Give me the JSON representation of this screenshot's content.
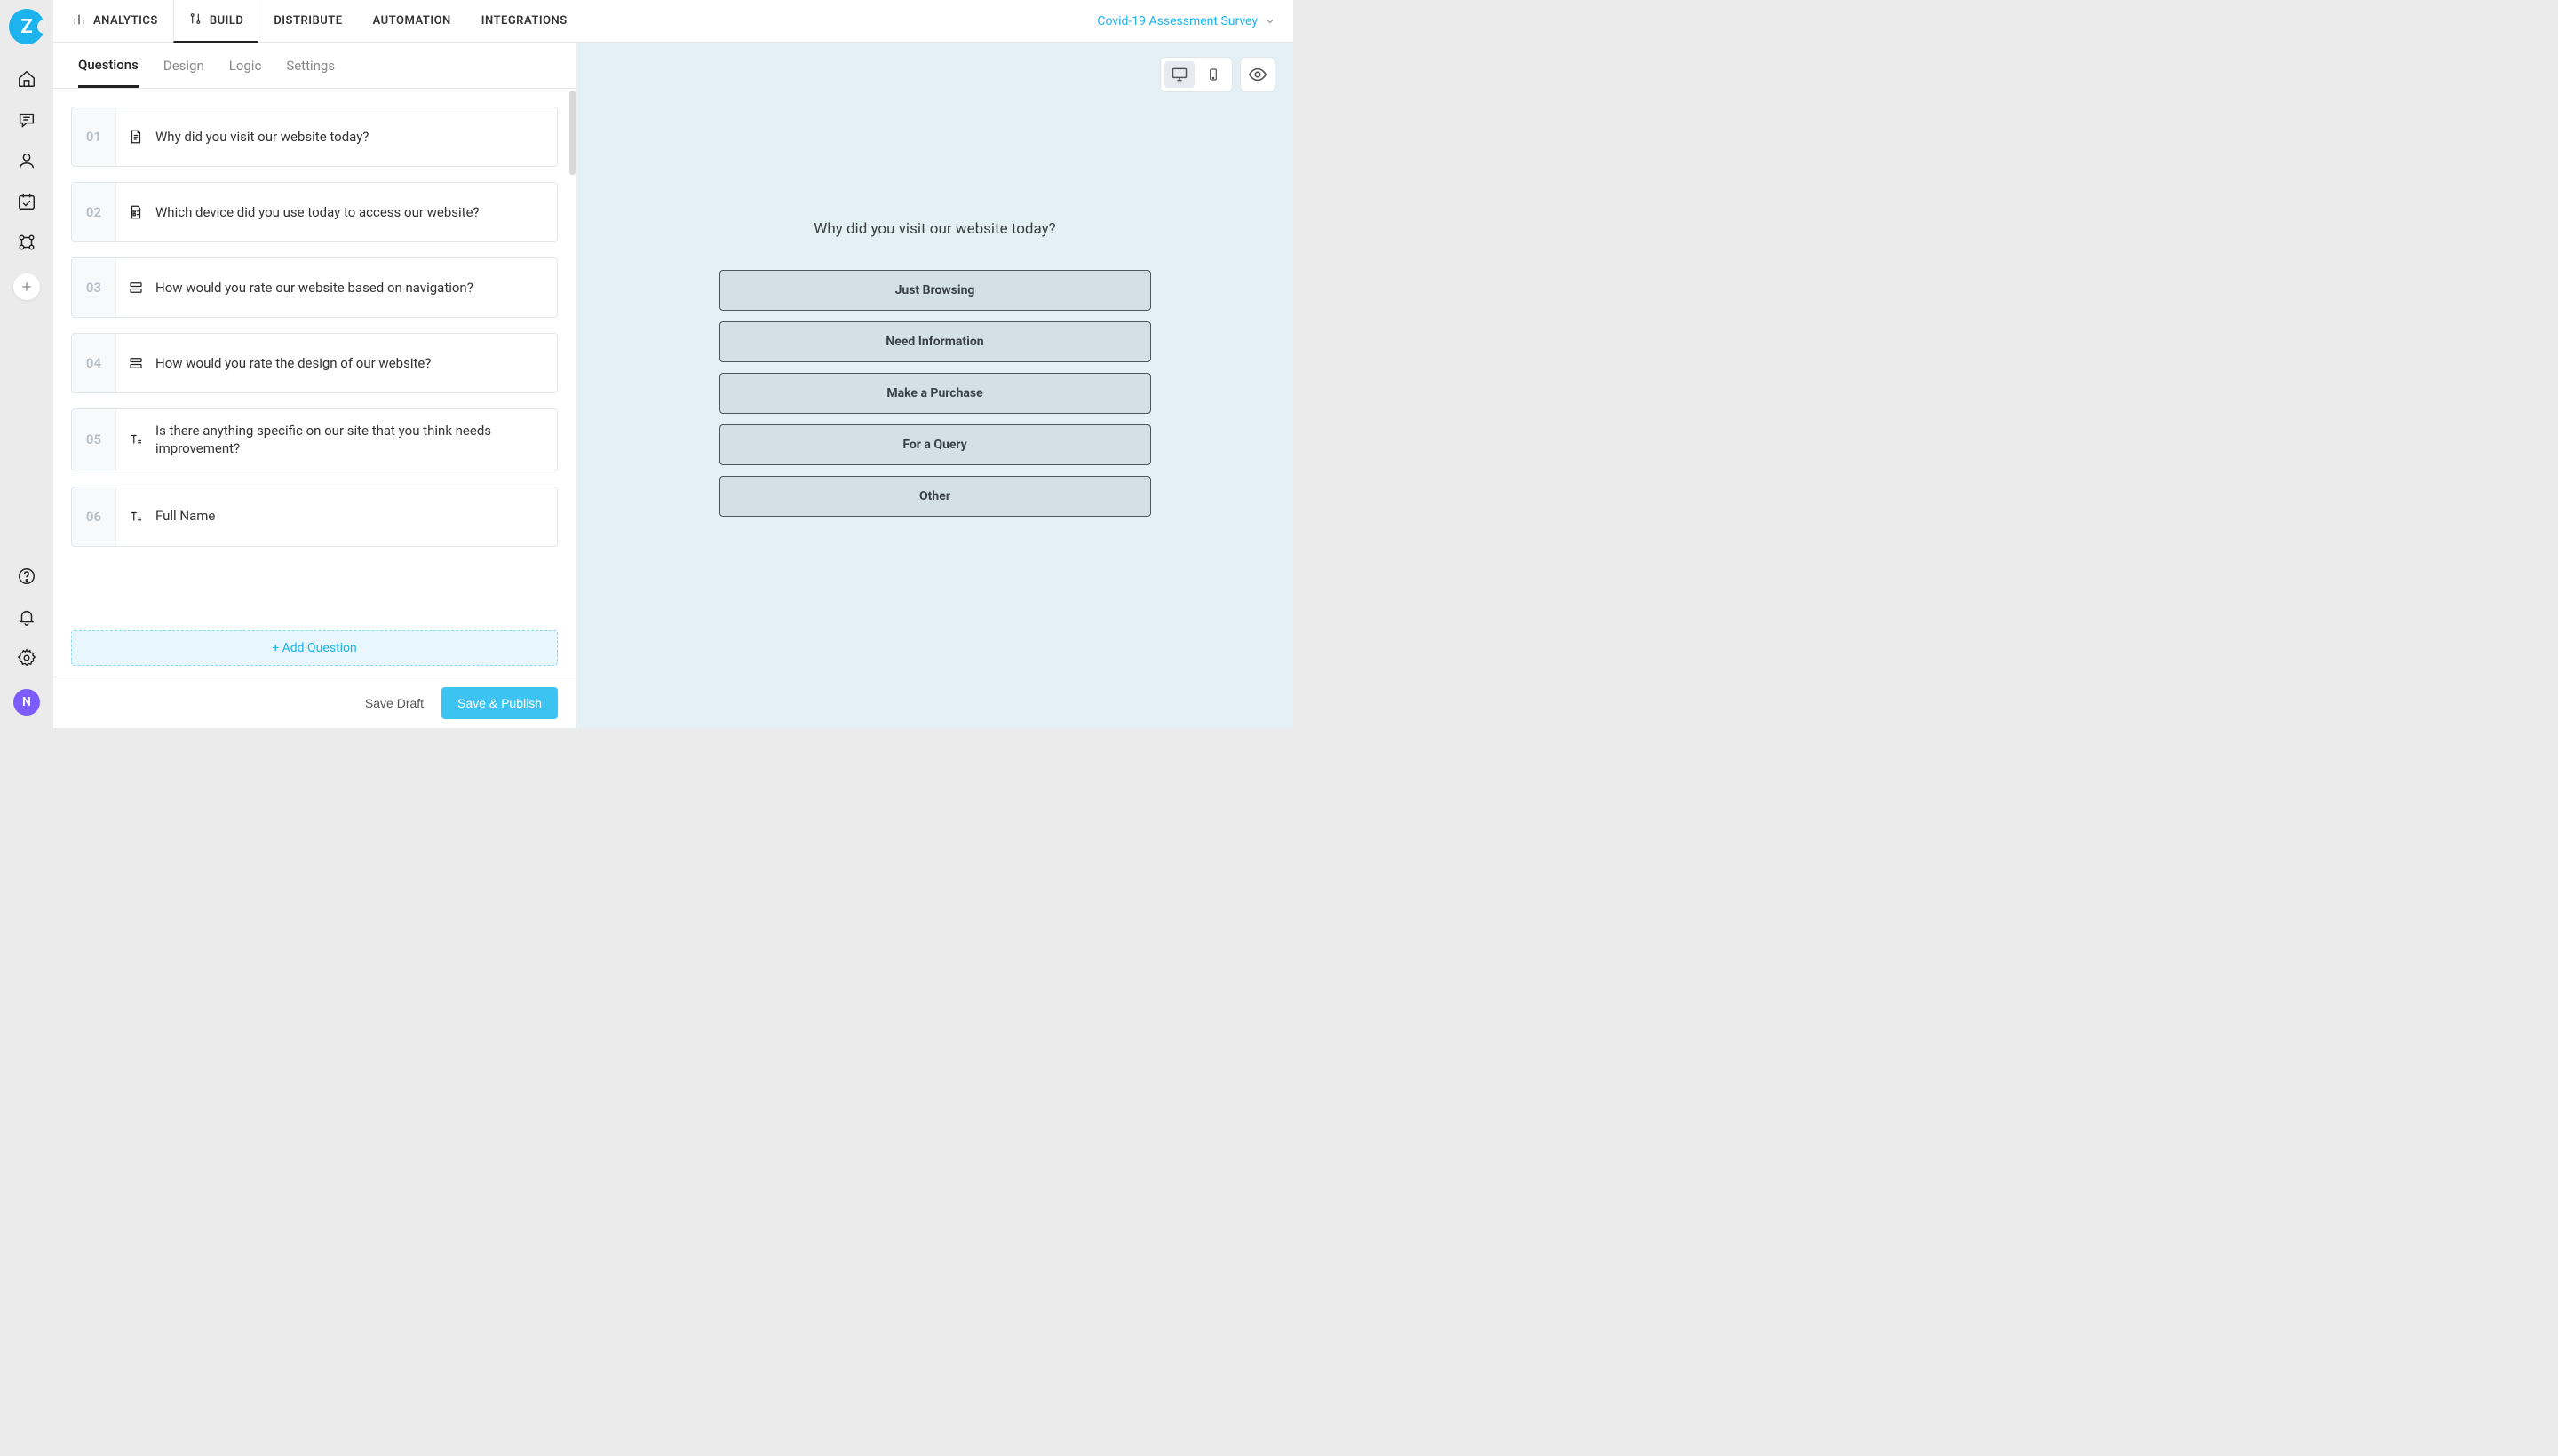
{
  "brand_letter": "Z",
  "topnav": {
    "items": [
      {
        "label": "ANALYTICS",
        "icon": "analytics"
      },
      {
        "label": "BUILD",
        "icon": "build",
        "active": true
      },
      {
        "label": "DISTRIBUTE"
      },
      {
        "label": "AUTOMATION"
      },
      {
        "label": "INTEGRATIONS"
      }
    ],
    "survey_name": "Covid-19 Assessment Survey"
  },
  "subtabs": [
    {
      "label": "Questions",
      "active": true
    },
    {
      "label": "Design"
    },
    {
      "label": "Logic"
    },
    {
      "label": "Settings"
    }
  ],
  "questions": [
    {
      "num": "01",
      "type": "page",
      "text": "Why did you visit our website today?"
    },
    {
      "num": "02",
      "type": "multichoice",
      "text": "Which device did you use today to access our website?"
    },
    {
      "num": "03",
      "type": "list",
      "text": "How would you rate our website based on navigation?"
    },
    {
      "num": "04",
      "type": "list",
      "text": "How would you rate the design of our website?"
    },
    {
      "num": "05",
      "type": "text",
      "text": "Is there anything specific on our site that you think needs improvement?"
    },
    {
      "num": "06",
      "type": "text",
      "text": "Full Name"
    }
  ],
  "add_question_label": "+ Add Question",
  "footer": {
    "save_draft": "Save Draft",
    "save_publish": "Save & Publish"
  },
  "preview": {
    "question": "Why did you visit our website today?",
    "options": [
      "Just Browsing",
      "Need Information",
      "Make a Purchase",
      "For a Query",
      "Other"
    ]
  },
  "avatar_initial": "N"
}
